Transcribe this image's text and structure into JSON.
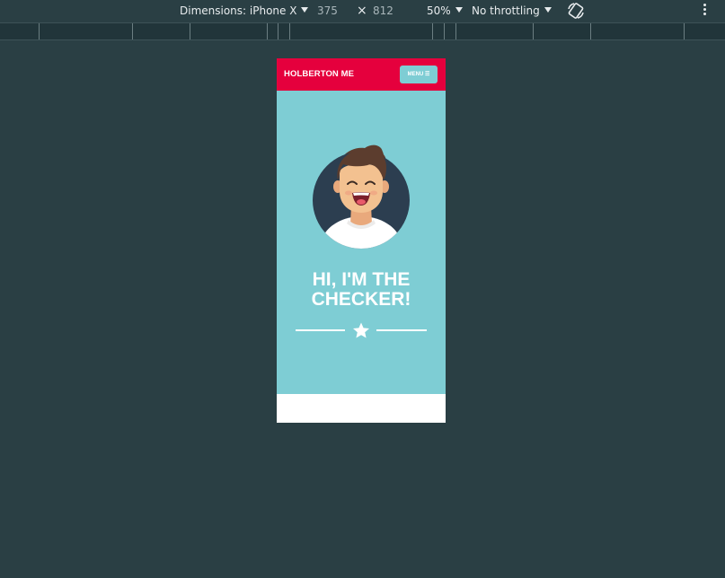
{
  "devtools": {
    "dimensions_label": "Dimensions: iPhone X",
    "width": "375",
    "times": "×",
    "height": "812",
    "zoom": "50%",
    "throttling": "No throttling",
    "icons": [
      "chevron-down-icon",
      "rotate-icon",
      "more-vertical-icon"
    ]
  },
  "site": {
    "brand": "HOLBERTON ME",
    "menu_label": "MENU ☰",
    "headline_line1": "HI, I'M THE",
    "headline_line2": "CHECKER!",
    "divider_icon": "star-icon",
    "colors": {
      "nav": "#e5003d",
      "hero": "#7ecdd4",
      "text": "#ffffff",
      "avatar_bg": "#2c3e50"
    }
  }
}
